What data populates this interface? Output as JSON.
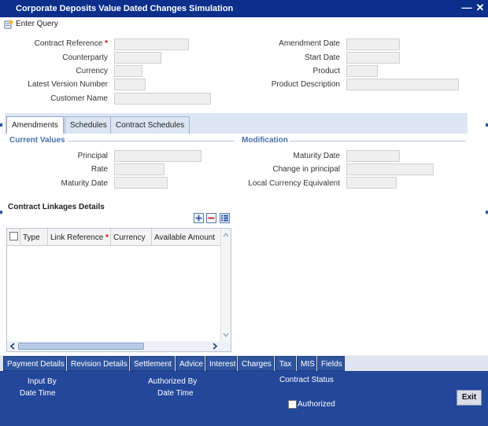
{
  "window": {
    "title": "Corporate Deposits Value Dated Changes Simulation",
    "minimize_glyph": "—",
    "close_glyph": "✕"
  },
  "toolbar": {
    "enter_query_label": "Enter Query",
    "enter_query_icon": "enter-query-icon"
  },
  "header_fields": {
    "contract_reference_label": "Contract Reference",
    "counterparty_label": "Counterparty",
    "currency_label": "Currency",
    "latest_version_number_label": "Latest Version Number",
    "customer_name_label": "Customer Name",
    "amendment_date_label": "Amendment Date",
    "start_date_label": "Start Date",
    "product_label": "Product",
    "product_description_label": "Product Description",
    "required_marker": "*"
  },
  "tabs": {
    "items": [
      {
        "label": "Amendments",
        "active": true
      },
      {
        "label": "Schedules",
        "active": false
      },
      {
        "label": "Contract Schedules",
        "active": false
      }
    ]
  },
  "current_values": {
    "section_title": "Current Values",
    "principal_label": "Principal",
    "rate_label": "Rate",
    "maturity_date_label": "Maturity Date"
  },
  "modification": {
    "section_title": "Modification",
    "maturity_date_label": "Maturity Date",
    "change_in_principal_label": "Change in principal",
    "local_currency_equivalent_label": "Local Currency Equivalent"
  },
  "linkages": {
    "title": "Contract Linkages Details",
    "add_icon": "+",
    "remove_icon": "−",
    "view_icon": "list-view-icon",
    "columns": [
      "Type",
      "Link Reference",
      "Currency",
      "Available Amount"
    ],
    "required_marker": "*"
  },
  "bottom_tabs": [
    "Payment Details",
    "Revision Details",
    "Settlement",
    "Advice",
    "Interest",
    "Charges",
    "Tax",
    "MIS",
    "Fields"
  ],
  "footer": {
    "input_by_label": "Input By",
    "date_time_label_1": "Date Time",
    "authorized_by_label": "Authorized By",
    "date_time_label_2": "Date Time",
    "contract_status_label": "Contract Status",
    "authorized_label": "Authorized",
    "exit_label": "Exit"
  },
  "colors": {
    "title_bar": "#0c2f8c",
    "footer": "#23479a",
    "section_title": "#4a6fa8",
    "required": "#e00000"
  }
}
